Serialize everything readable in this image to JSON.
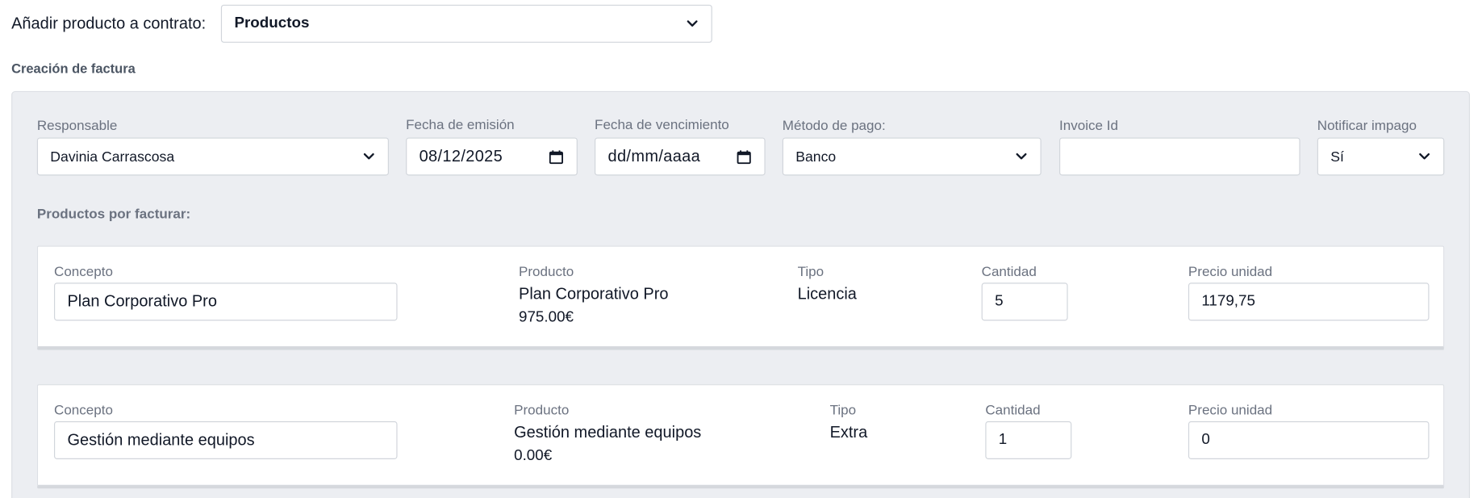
{
  "top": {
    "label": "Añadir producto a contrato:",
    "select_value": "Productos"
  },
  "section_title": "Creación de factura",
  "form": {
    "responsable_label": "Responsable",
    "responsable_value": "Davinia Carrascosa",
    "fecha_emision_label": "Fecha de emisión",
    "fecha_emision_value": "08/12/2025",
    "fecha_vencimiento_label": "Fecha de vencimiento",
    "fecha_vencimiento_value": "dd/mm/aaaa",
    "metodo_pago_label": "Método de pago:",
    "metodo_pago_value": "Banco",
    "invoice_id_label": "Invoice Id",
    "invoice_id_value": "",
    "notificar_label": "Notificar impago",
    "notificar_value": "Sí"
  },
  "products_heading": "Productos por facturar:",
  "products": [
    {
      "concepto_label": "Concepto",
      "concepto_value": "Plan Corporativo Pro",
      "producto_label": "Producto",
      "producto_name": "Plan Corporativo Pro",
      "producto_price": "975.00€",
      "tipo_label": "Tipo",
      "tipo_value": "Licencia",
      "cantidad_label": "Cantidad",
      "cantidad_value": "5",
      "precio_label": "Precio unidad",
      "precio_value": "1179,75"
    },
    {
      "concepto_label": "Concepto",
      "concepto_value": "Gestión mediante equipos",
      "producto_label": "Producto",
      "producto_name": "Gestión mediante equipos",
      "producto_price": "0.00€",
      "tipo_label": "Tipo",
      "tipo_value": "Extra",
      "cantidad_label": "Cantidad",
      "cantidad_value": "1",
      "precio_label": "Precio unidad",
      "precio_value": "0"
    }
  ],
  "icons": {
    "dropdown": "chevron-down-icon",
    "date": "calendar-icon"
  },
  "colors": {
    "panel_bg": "#eceef2",
    "label": "#6b7280",
    "text": "#111827"
  }
}
